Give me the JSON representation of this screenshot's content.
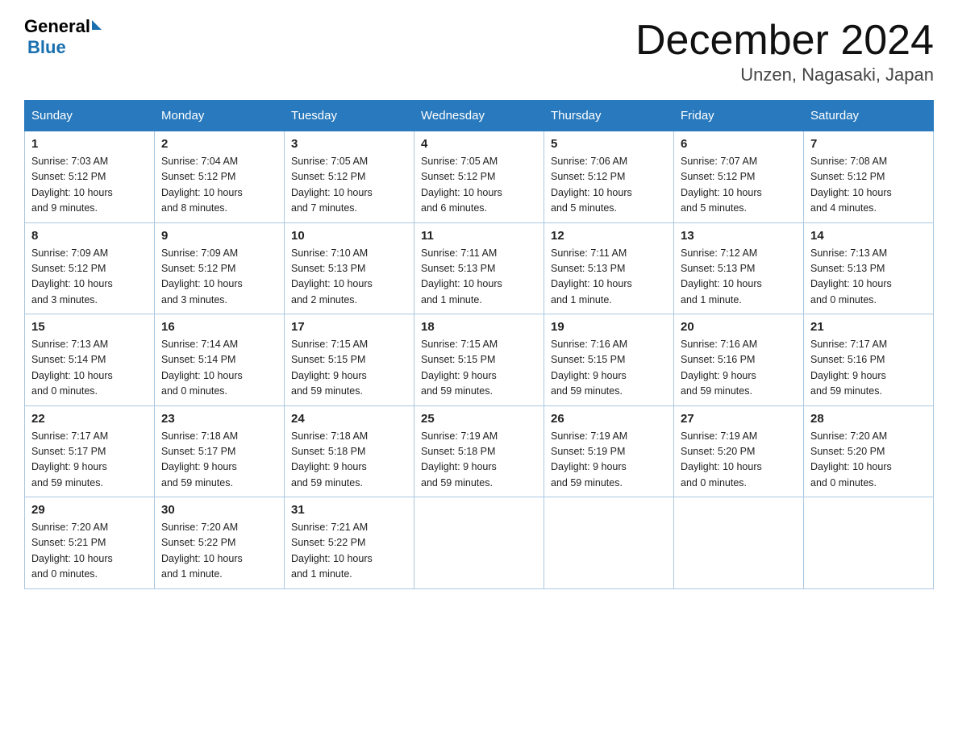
{
  "header": {
    "logo_general": "General",
    "logo_blue": "Blue",
    "title": "December 2024",
    "subtitle": "Unzen, Nagasaki, Japan"
  },
  "weekdays": [
    "Sunday",
    "Monday",
    "Tuesday",
    "Wednesday",
    "Thursday",
    "Friday",
    "Saturday"
  ],
  "weeks": [
    [
      {
        "day": "1",
        "sunrise": "7:03 AM",
        "sunset": "5:12 PM",
        "daylight": "10 hours and 9 minutes."
      },
      {
        "day": "2",
        "sunrise": "7:04 AM",
        "sunset": "5:12 PM",
        "daylight": "10 hours and 8 minutes."
      },
      {
        "day": "3",
        "sunrise": "7:05 AM",
        "sunset": "5:12 PM",
        "daylight": "10 hours and 7 minutes."
      },
      {
        "day": "4",
        "sunrise": "7:05 AM",
        "sunset": "5:12 PM",
        "daylight": "10 hours and 6 minutes."
      },
      {
        "day": "5",
        "sunrise": "7:06 AM",
        "sunset": "5:12 PM",
        "daylight": "10 hours and 5 minutes."
      },
      {
        "day": "6",
        "sunrise": "7:07 AM",
        "sunset": "5:12 PM",
        "daylight": "10 hours and 5 minutes."
      },
      {
        "day": "7",
        "sunrise": "7:08 AM",
        "sunset": "5:12 PM",
        "daylight": "10 hours and 4 minutes."
      }
    ],
    [
      {
        "day": "8",
        "sunrise": "7:09 AM",
        "sunset": "5:12 PM",
        "daylight": "10 hours and 3 minutes."
      },
      {
        "day": "9",
        "sunrise": "7:09 AM",
        "sunset": "5:12 PM",
        "daylight": "10 hours and 3 minutes."
      },
      {
        "day": "10",
        "sunrise": "7:10 AM",
        "sunset": "5:13 PM",
        "daylight": "10 hours and 2 minutes."
      },
      {
        "day": "11",
        "sunrise": "7:11 AM",
        "sunset": "5:13 PM",
        "daylight": "10 hours and 1 minute."
      },
      {
        "day": "12",
        "sunrise": "7:11 AM",
        "sunset": "5:13 PM",
        "daylight": "10 hours and 1 minute."
      },
      {
        "day": "13",
        "sunrise": "7:12 AM",
        "sunset": "5:13 PM",
        "daylight": "10 hours and 1 minute."
      },
      {
        "day": "14",
        "sunrise": "7:13 AM",
        "sunset": "5:13 PM",
        "daylight": "10 hours and 0 minutes."
      }
    ],
    [
      {
        "day": "15",
        "sunrise": "7:13 AM",
        "sunset": "5:14 PM",
        "daylight": "10 hours and 0 minutes."
      },
      {
        "day": "16",
        "sunrise": "7:14 AM",
        "sunset": "5:14 PM",
        "daylight": "10 hours and 0 minutes."
      },
      {
        "day": "17",
        "sunrise": "7:15 AM",
        "sunset": "5:15 PM",
        "daylight": "9 hours and 59 minutes."
      },
      {
        "day": "18",
        "sunrise": "7:15 AM",
        "sunset": "5:15 PM",
        "daylight": "9 hours and 59 minutes."
      },
      {
        "day": "19",
        "sunrise": "7:16 AM",
        "sunset": "5:15 PM",
        "daylight": "9 hours and 59 minutes."
      },
      {
        "day": "20",
        "sunrise": "7:16 AM",
        "sunset": "5:16 PM",
        "daylight": "9 hours and 59 minutes."
      },
      {
        "day": "21",
        "sunrise": "7:17 AM",
        "sunset": "5:16 PM",
        "daylight": "9 hours and 59 minutes."
      }
    ],
    [
      {
        "day": "22",
        "sunrise": "7:17 AM",
        "sunset": "5:17 PM",
        "daylight": "9 hours and 59 minutes."
      },
      {
        "day": "23",
        "sunrise": "7:18 AM",
        "sunset": "5:17 PM",
        "daylight": "9 hours and 59 minutes."
      },
      {
        "day": "24",
        "sunrise": "7:18 AM",
        "sunset": "5:18 PM",
        "daylight": "9 hours and 59 minutes."
      },
      {
        "day": "25",
        "sunrise": "7:19 AM",
        "sunset": "5:18 PM",
        "daylight": "9 hours and 59 minutes."
      },
      {
        "day": "26",
        "sunrise": "7:19 AM",
        "sunset": "5:19 PM",
        "daylight": "9 hours and 59 minutes."
      },
      {
        "day": "27",
        "sunrise": "7:19 AM",
        "sunset": "5:20 PM",
        "daylight": "10 hours and 0 minutes."
      },
      {
        "day": "28",
        "sunrise": "7:20 AM",
        "sunset": "5:20 PM",
        "daylight": "10 hours and 0 minutes."
      }
    ],
    [
      {
        "day": "29",
        "sunrise": "7:20 AM",
        "sunset": "5:21 PM",
        "daylight": "10 hours and 0 minutes."
      },
      {
        "day": "30",
        "sunrise": "7:20 AM",
        "sunset": "5:22 PM",
        "daylight": "10 hours and 1 minute."
      },
      {
        "day": "31",
        "sunrise": "7:21 AM",
        "sunset": "5:22 PM",
        "daylight": "10 hours and 1 minute."
      },
      null,
      null,
      null,
      null
    ]
  ],
  "labels": {
    "sunrise": "Sunrise:",
    "sunset": "Sunset:",
    "daylight": "Daylight:"
  }
}
